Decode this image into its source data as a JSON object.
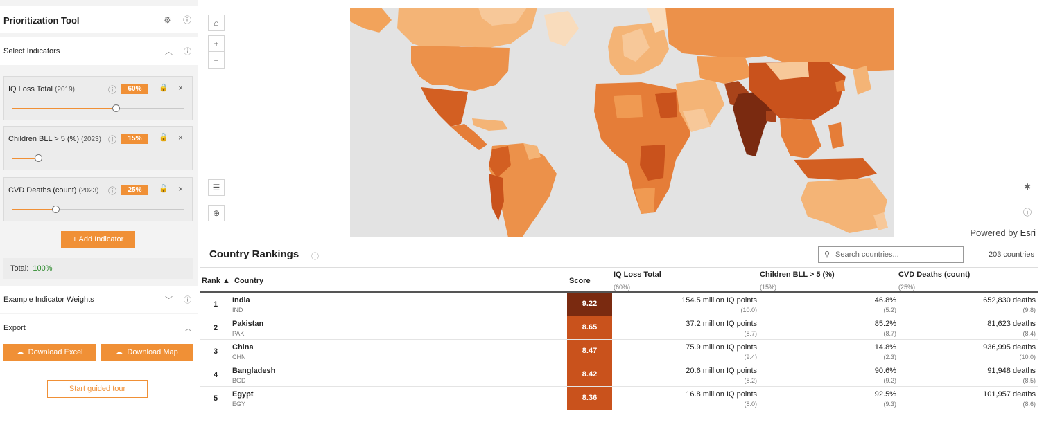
{
  "sidebar": {
    "title": "Prioritization Tool",
    "select_indicators": "Select Indicators",
    "indicators": [
      {
        "name": "IQ Loss Total",
        "year": "(2019)",
        "weight": "60%",
        "slider": 0.6
      },
      {
        "name": "Children BLL > 5 (%)",
        "year": "(2023)",
        "weight": "15%",
        "slider": 0.15
      },
      {
        "name": "CVD Deaths (count)",
        "year": "(2023)",
        "weight": "25%",
        "slider": 0.25
      }
    ],
    "add_indicator": "+  Add Indicator",
    "total_label": "Total:",
    "total_value": "100%",
    "example_weights": "Example Indicator Weights",
    "export": "Export",
    "download_excel": "Download Excel",
    "download_map": "Download Map",
    "guided_tour": "Start guided tour"
  },
  "map": {
    "powered_prefix": "Powered by ",
    "powered_link": "Esri"
  },
  "rankings": {
    "title": "Country Rankings",
    "search_placeholder": "Search countries...",
    "count": "203 countries",
    "headers": {
      "rank": "Rank ▲",
      "country": "Country",
      "score": "Score",
      "ind1": "IQ Loss Total",
      "ind1_w": "(60%)",
      "ind2": "Children BLL > 5 (%)",
      "ind2_w": "(15%)",
      "ind3": "CVD Deaths (count)",
      "ind3_w": "(25%)"
    },
    "rows": [
      {
        "rank": "1",
        "country": "India",
        "code": "IND",
        "score": "9.22",
        "ind1": "154.5 million IQ points",
        "ind1_s": "(10.0)",
        "ind2": "46.8%",
        "ind2_s": "(5.2)",
        "ind3": "652,830 deaths",
        "ind3_s": "(9.8)"
      },
      {
        "rank": "2",
        "country": "Pakistan",
        "code": "PAK",
        "score": "8.65",
        "ind1": "37.2 million IQ points",
        "ind1_s": "(8.7)",
        "ind2": "85.2%",
        "ind2_s": "(8.7)",
        "ind3": "81,623 deaths",
        "ind3_s": "(8.4)"
      },
      {
        "rank": "3",
        "country": "China",
        "code": "CHN",
        "score": "8.47",
        "ind1": "75.9 million IQ points",
        "ind1_s": "(9.4)",
        "ind2": "14.8%",
        "ind2_s": "(2.3)",
        "ind3": "936,995 deaths",
        "ind3_s": "(10.0)"
      },
      {
        "rank": "4",
        "country": "Bangladesh",
        "code": "BGD",
        "score": "8.42",
        "ind1": "20.6 million IQ points",
        "ind1_s": "(8.2)",
        "ind2": "90.6%",
        "ind2_s": "(9.2)",
        "ind3": "91,948 deaths",
        "ind3_s": "(8.5)"
      },
      {
        "rank": "5",
        "country": "Egypt",
        "code": "EGY",
        "score": "8.36",
        "ind1": "16.8 million IQ points",
        "ind1_s": "(8.0)",
        "ind2": "92.5%",
        "ind2_s": "(9.3)",
        "ind3": "101,957 deaths",
        "ind3_s": "(8.6)"
      }
    ]
  },
  "colors": {
    "accent": "#f09036",
    "score_high": "#7a2a10",
    "score_mid": "#c9521c",
    "map_water": "#e3e3e3"
  }
}
